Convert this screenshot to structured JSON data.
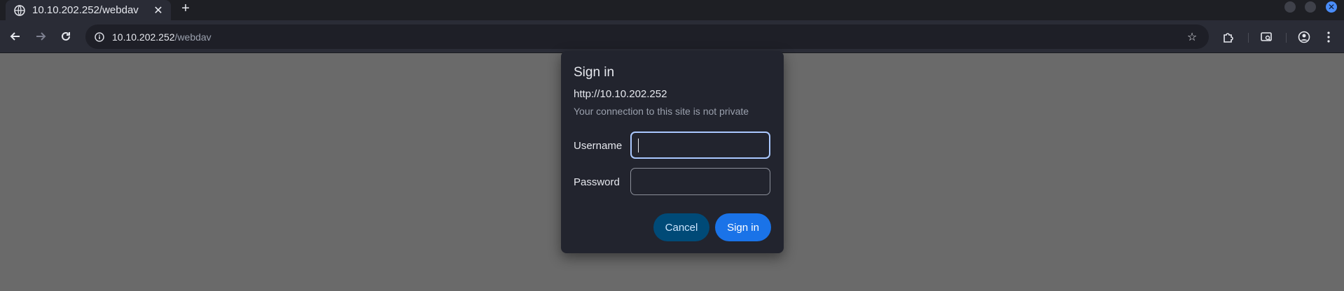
{
  "tab": {
    "title": "10.10.202.252/webdav",
    "globe_icon": "globe-icon",
    "close_icon": "close-icon"
  },
  "new_tab": {
    "label": "+"
  },
  "address_bar": {
    "host": "10.10.202.252",
    "path": "/webdav"
  },
  "dialog": {
    "title": "Sign in",
    "url": "http://10.10.202.252",
    "warning": "Your connection to this site is not private",
    "username_label": "Username",
    "username_value": "",
    "password_label": "Password",
    "password_value": "",
    "cancel_label": "Cancel",
    "signin_label": "Sign in"
  },
  "colors": {
    "accent": "#1a73e8",
    "cancel_bg": "#004a77",
    "dialog_bg": "#22242e",
    "page_bg": "#6a6a6a"
  }
}
